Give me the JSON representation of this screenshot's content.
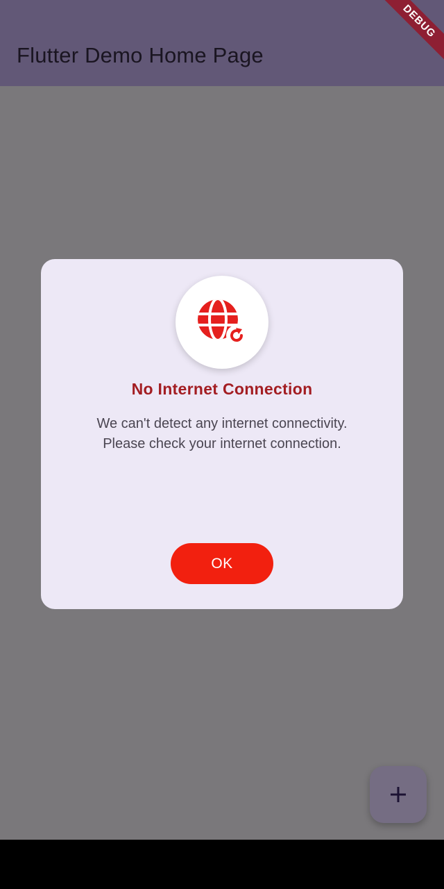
{
  "app_bar": {
    "title": "Flutter Demo Home Page",
    "debug_label": "DEBUG"
  },
  "dialog": {
    "icon": "globe-refresh-icon",
    "title": "No Internet Connection",
    "message_line1": "We can't detect any internet connectivity.",
    "message_line2": "Please check your internet connection.",
    "ok_label": "OK"
  },
  "fab": {
    "icon": "plus-icon"
  },
  "colors": {
    "app_bar": "#625877",
    "scrim_background": "#7a787b",
    "dialog_background": "#ede8f6",
    "title_red": "#a31d22",
    "button_red": "#f2200f",
    "icon_red": "#e5201e",
    "debug_ribbon": "#8e1f33",
    "fab_background": "#756d83"
  }
}
